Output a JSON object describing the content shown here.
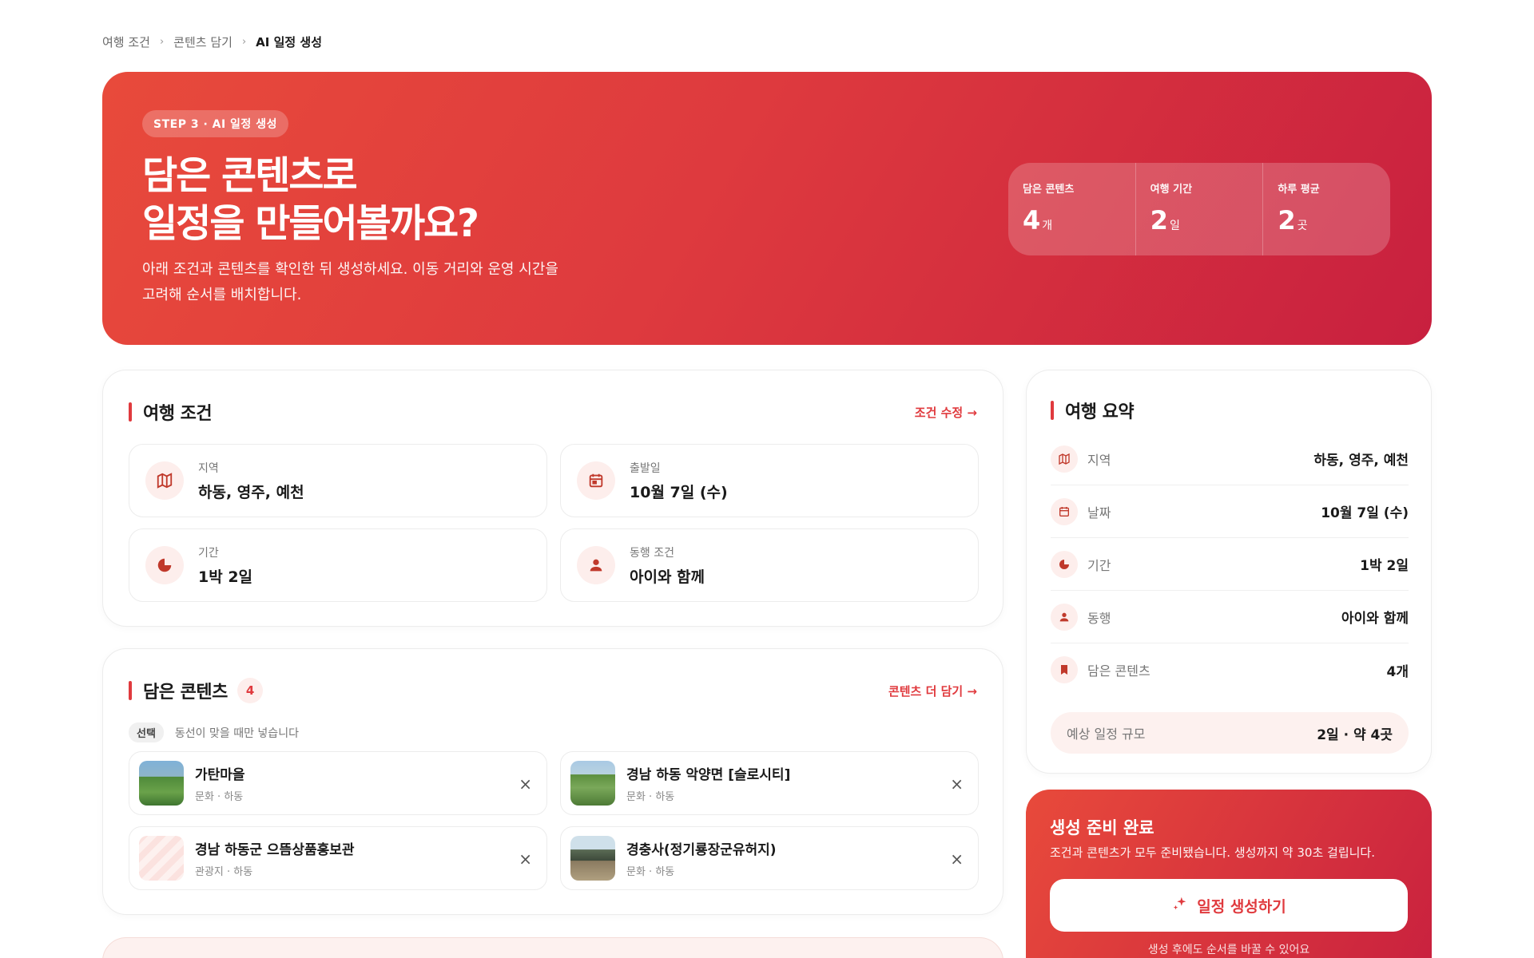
{
  "breadcrumb": {
    "step1": "여행 조건",
    "step2": "콘텐츠 담기",
    "step3": "AI 일정 생성",
    "sep": "›"
  },
  "hero": {
    "pill": "STEP 3 · AI 일정 생성",
    "title_line1": "담은 콘텐츠로",
    "title_line2": "일정을 만들어볼까요?",
    "desc_line1": "아래 조건과 콘텐츠를 확인한 뒤 생성하세요. 이동 거리와 운영 시간을",
    "desc_line2": "고려해 순서를 배치합니다.",
    "stats": [
      {
        "label": "담은 콘텐츠",
        "value": "4",
        "unit": "개"
      },
      {
        "label": "여행 기간",
        "value": "2",
        "unit": "일"
      },
      {
        "label": "하루 평균",
        "value": "2",
        "unit": "곳"
      }
    ]
  },
  "conditions": {
    "title": "여행 조건",
    "edit_link": "조건 수정 →",
    "items": [
      {
        "label": "지역",
        "value": "하동, 영주, 예천",
        "icon": "map-icon"
      },
      {
        "label": "출발일",
        "value": "10월 7일 (수)",
        "icon": "calendar-icon"
      },
      {
        "label": "기간",
        "value": "1박 2일",
        "icon": "clock-icon"
      },
      {
        "label": "동행 조건",
        "value": "아이와 함께",
        "icon": "person-icon"
      }
    ]
  },
  "contents": {
    "title": "담은 콘텐츠",
    "count": "4",
    "more_link": "콘텐츠 더 담기 →",
    "option_tag": "선택",
    "option_text": "동선이 맞을 때만 넣습니다",
    "items": [
      {
        "name": "가탄마을",
        "sub": "문화 · 하동"
      },
      {
        "name": "경남 하동 악양면 [슬로시티]",
        "sub": "문화 · 하동"
      },
      {
        "name": "경남 하동군 으뜸상품홍보관",
        "sub": "관광지 · 하동"
      },
      {
        "name": "경충사(정기룡장군유허지)",
        "sub": "문화 · 하동"
      }
    ],
    "remove_glyph": "×"
  },
  "summary": {
    "title": "여행 요약",
    "rows": [
      {
        "key": "지역",
        "value": "하동, 영주, 예천",
        "icon": "map-icon"
      },
      {
        "key": "날짜",
        "value": "10월 7일 (수)",
        "icon": "calendar-icon"
      },
      {
        "key": "기간",
        "value": "1박 2일",
        "icon": "clock-icon"
      },
      {
        "key": "동행",
        "value": "아이와 함께",
        "icon": "person-icon"
      },
      {
        "key": "담은 콘텐츠",
        "value": "4개",
        "icon": "bookmark-icon"
      }
    ],
    "scale_label": "예상 일정 규모",
    "scale_value": "2일 · 약 4곳"
  },
  "ready": {
    "title": "생성 준비 완료",
    "desc": "조건과 콘텐츠가 모두 준비됐습니다. 생성까지 약 30초 걸립니다.",
    "button": "일정 생성하기",
    "note": "생성 후에도 순서를 바꿀 수 있어요"
  },
  "colors": {
    "accent": "#e03a3e",
    "accent_soft": "#fdeeec"
  }
}
